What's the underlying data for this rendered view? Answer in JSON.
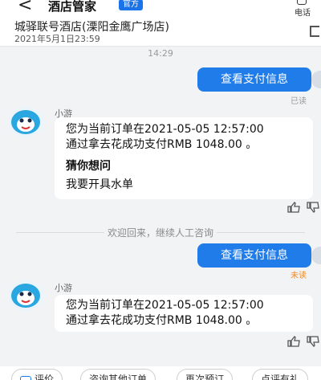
{
  "header": {
    "back_icon": "<",
    "title": "酒店管家",
    "badge": "官方",
    "phone_label": "电话"
  },
  "hotel": {
    "name": "城驿联号酒店(溧阳金鹰广场店)",
    "date": "2021年5月1日23:59"
  },
  "chat": {
    "time": "14:29",
    "msg1": {
      "text": "查看支付信息",
      "status": "已读"
    },
    "agent1": {
      "name": "小游",
      "line1": "您为当前订单在2021-05-05 12:57:00",
      "line2": "通过拿去花成功支付RMB 1048.00 。",
      "guess_title": "猜你想问",
      "guess_item": "我要开具水单"
    },
    "notice": "欢迎回来，继续人工咨询",
    "msg2": {
      "text": "查看支付信息",
      "status": "未读"
    },
    "agent2": {
      "name": "小游",
      "line1": "您为当前订单在2021-05-05 12:57:00",
      "line2": "通过拿去花成功支付RMB 1048.00 。"
    }
  },
  "quick_actions": [
    "评价",
    "咨询其他订单",
    "再次预订",
    "点评有礼"
  ],
  "colors": {
    "accent": "#1f7ce8",
    "read": "#9a9a9a",
    "unread": "#f08a24"
  }
}
